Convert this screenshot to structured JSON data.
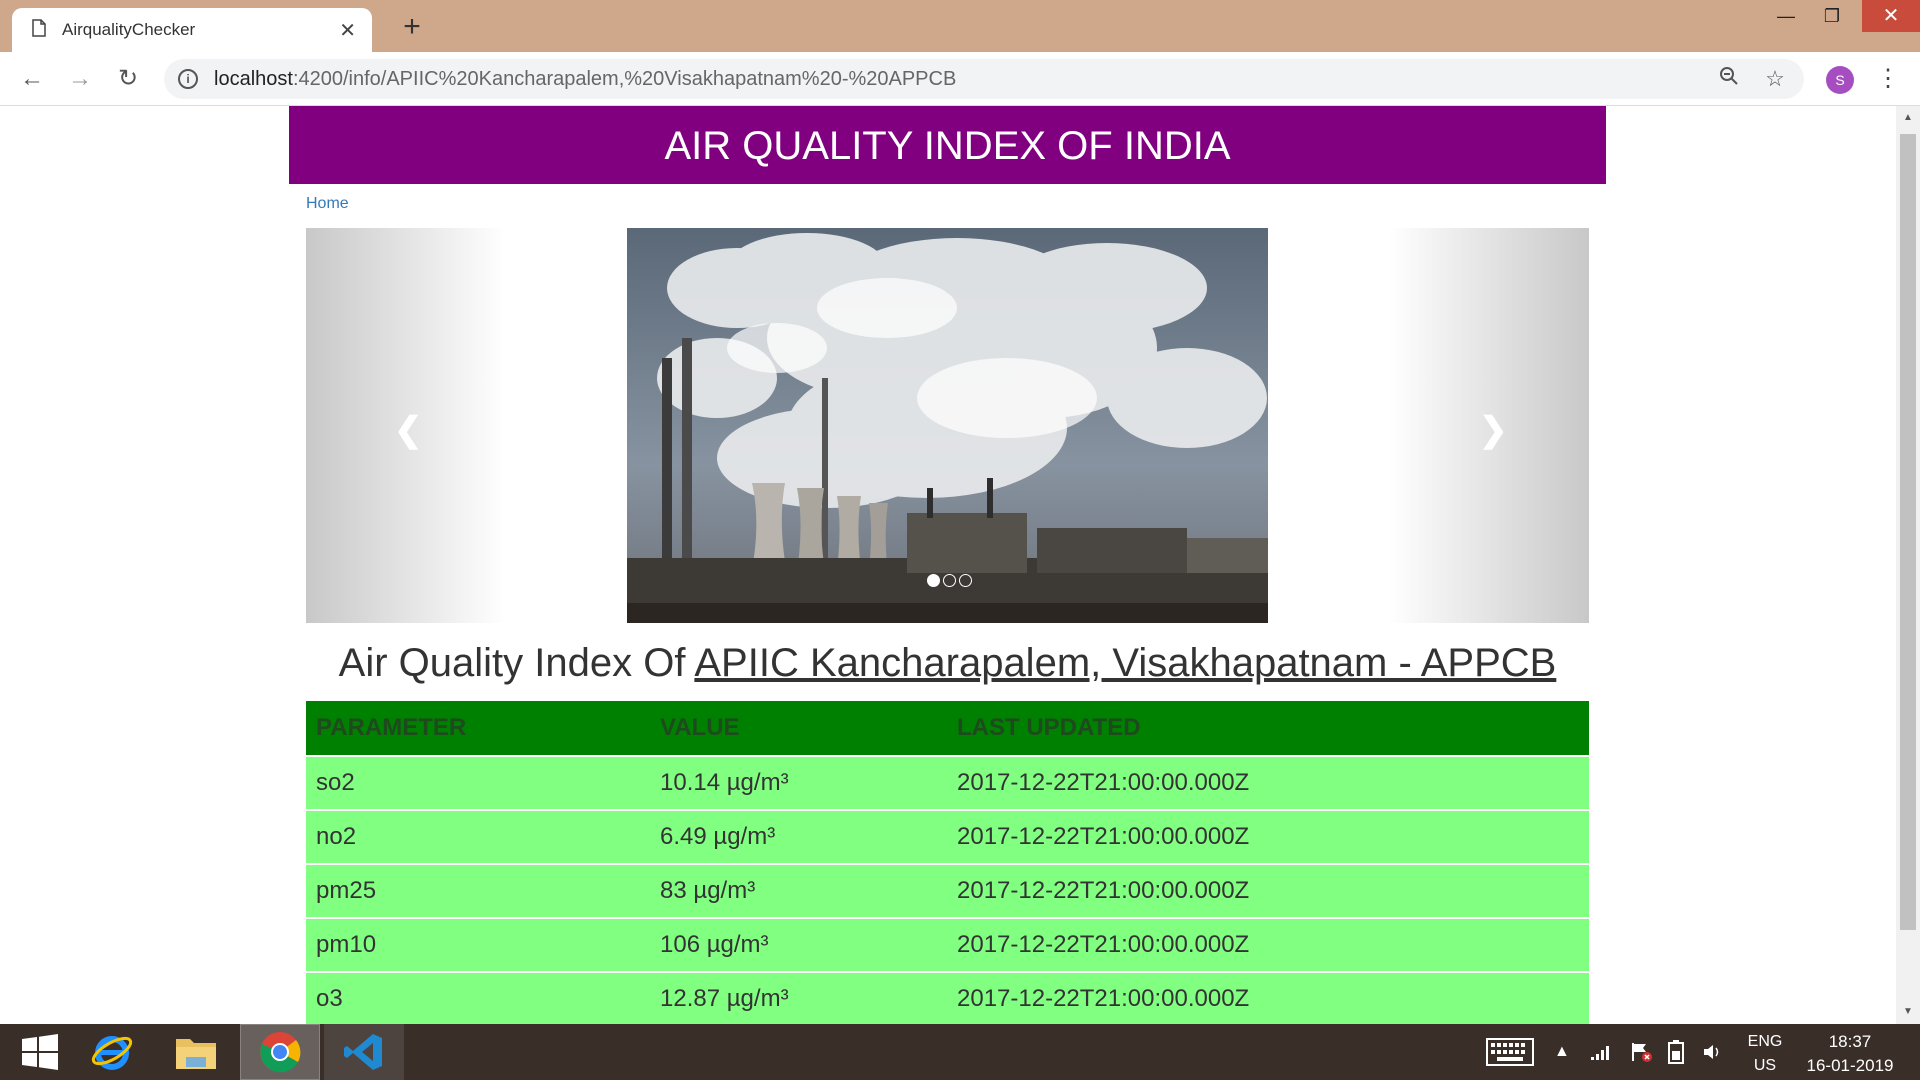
{
  "browser": {
    "tab_title": "AirqualityChecker",
    "url_host": "localhost",
    "url_rest": ":4200/info/APIIC%20Kancharapalem,%20Visakhapatnam%20-%20APPCB",
    "profile_initial": "S"
  },
  "page": {
    "header_title": "AIR QUALITY INDEX OF INDIA",
    "home_link": "Home",
    "heading_prefix": "Air Quality Index Of ",
    "station_name": "APIIC Kancharapalem, Visakhapatnam - APPCB",
    "carousel": {
      "prev_icon": "chevron-left-icon",
      "next_icon": "chevron-right-icon",
      "slide_count": 3,
      "active_slide": 1
    },
    "table": {
      "headers": [
        "PARAMETER",
        "VALUE",
        "LAST UPDATED"
      ],
      "rows": [
        {
          "parameter": "so2",
          "value": "10.14 µg/m³",
          "updated": "2017-12-22T21:00:00.000Z"
        },
        {
          "parameter": "no2",
          "value": "6.49 µg/m³",
          "updated": "2017-12-22T21:00:00.000Z"
        },
        {
          "parameter": "pm25",
          "value": "83 µg/m³",
          "updated": "2017-12-22T21:00:00.000Z"
        },
        {
          "parameter": "pm10",
          "value": "106 µg/m³",
          "updated": "2017-12-22T21:00:00.000Z"
        },
        {
          "parameter": "o3",
          "value": "12.87 µg/m³",
          "updated": "2017-12-22T21:00:00.000Z"
        }
      ]
    }
  },
  "colors": {
    "header_bg": "#800080",
    "table_header_bg": "#008000",
    "table_row_bg": "#80ff80",
    "link": "#337ab7"
  },
  "taskbar": {
    "lang_top": "ENG",
    "lang_bottom": "US",
    "time": "18:37",
    "date": "16-01-2019"
  }
}
